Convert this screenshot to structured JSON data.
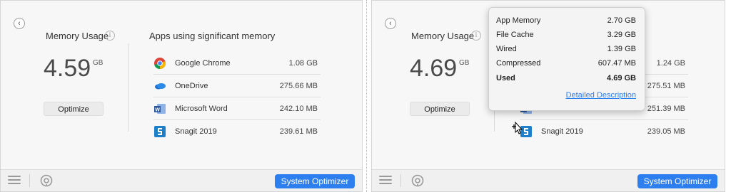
{
  "left_panel": {
    "memory_label": "Memory Usage",
    "info_glyph": "i",
    "memory_value": "4.59",
    "memory_unit": "GB",
    "optimize_label": "Optimize",
    "apps_title": "Apps using significant memory",
    "apps": [
      {
        "name": "Google Chrome",
        "size": "1.08 GB",
        "icon": "chrome-icon"
      },
      {
        "name": "OneDrive",
        "size": "275.66 MB",
        "icon": "onedrive-icon"
      },
      {
        "name": "Microsoft Word",
        "size": "242.10 MB",
        "icon": "word-icon"
      },
      {
        "name": "Snagit 2019",
        "size": "239.61 MB",
        "icon": "snagit-icon"
      }
    ],
    "system_optimizer_label": "System Optimizer"
  },
  "right_panel": {
    "memory_label": "Memory Usage",
    "info_glyph": "i",
    "memory_value": "4.69",
    "memory_unit": "GB",
    "optimize_label": "Optimize",
    "apps": [
      {
        "name": "",
        "size": "1.24 GB"
      },
      {
        "name": "",
        "size": "275.51 MB"
      },
      {
        "name": "Microsoft Word",
        "size": "251.39 MB"
      },
      {
        "name": "Snagit 2019",
        "size": "239.05 MB"
      }
    ],
    "system_optimizer_label": "System Optimizer",
    "popover": {
      "rows": [
        {
          "label": "App Memory",
          "value": "2.70 GB"
        },
        {
          "label": "File Cache",
          "value": "3.29 GB"
        },
        {
          "label": "Wired",
          "value": "1.39 GB"
        },
        {
          "label": "Compressed",
          "value": "607.47 MB"
        },
        {
          "label": "Used",
          "value": "4.69 GB"
        }
      ],
      "link": "Detailed Description"
    }
  },
  "colors": {
    "accent": "#2d7ff0",
    "panel_bg": "#f7f7f7"
  },
  "back_glyph": "‹"
}
